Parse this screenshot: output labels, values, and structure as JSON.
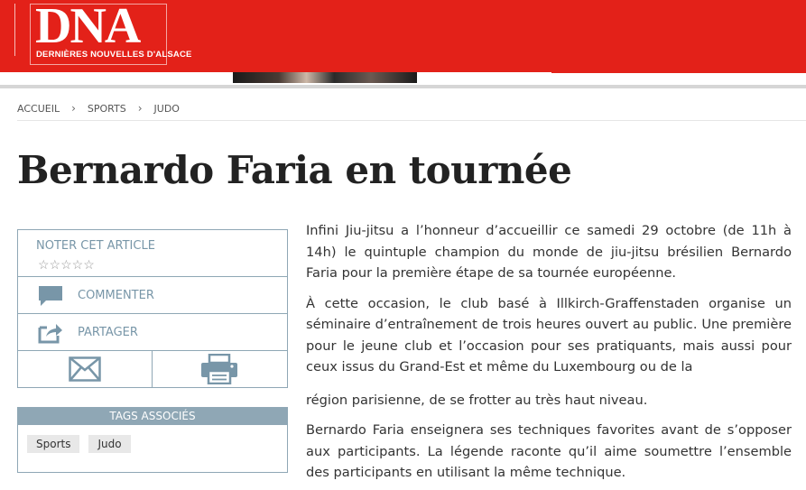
{
  "brand": {
    "logo_text": "DNA",
    "logo_subtitle": "DERNIÈRES NOUVELLES D'ALSACE",
    "accent_color": "#e32119",
    "box_color": "#8fa7b5"
  },
  "breadcrumb": [
    "ACCUEIL",
    "SPORTS",
    "JUDO"
  ],
  "breadcrumb_separator": "›",
  "article": {
    "title": "Bernardo Faria en tournée",
    "paragraphs": [
      "Infini Jiu-jitsu a l’honneur d’accueillir ce samedi 29 octobre (de 11h à 14h) le quintuple champion du monde de jiu-jitsu brésilien Bernardo Faria pour la première étape de sa tournée européenne.",
      "À cette occasion, le club basé à Illkirch-Graffenstaden organise un séminaire d’entraînement de trois heures ouvert au public. Une première pour le jeune club et l’occasion pour ses pratiquants, mais aussi pour ceux issus du Grand-Est et même du Luxembourg ou de la",
      "région parisienne, de se frotter au très haut niveau.",
      "Bernardo Faria enseignera ses techniques favorites avant de s’opposer aux participants. La légende raconte qu’il aime soumettre l’ensemble des participants en utilisant la même technique."
    ]
  },
  "tools": {
    "rate_label": "NOTER CET ARTICLE",
    "rating_stars": "☆☆☆☆☆",
    "comment_label": "COMMENTER",
    "share_label": "PARTAGER",
    "icons": [
      "comment-icon",
      "share-icon",
      "email-icon",
      "print-icon"
    ]
  },
  "tags": {
    "heading": "TAGS ASSOCIÉS",
    "items": [
      "Sports",
      "Judo"
    ]
  }
}
